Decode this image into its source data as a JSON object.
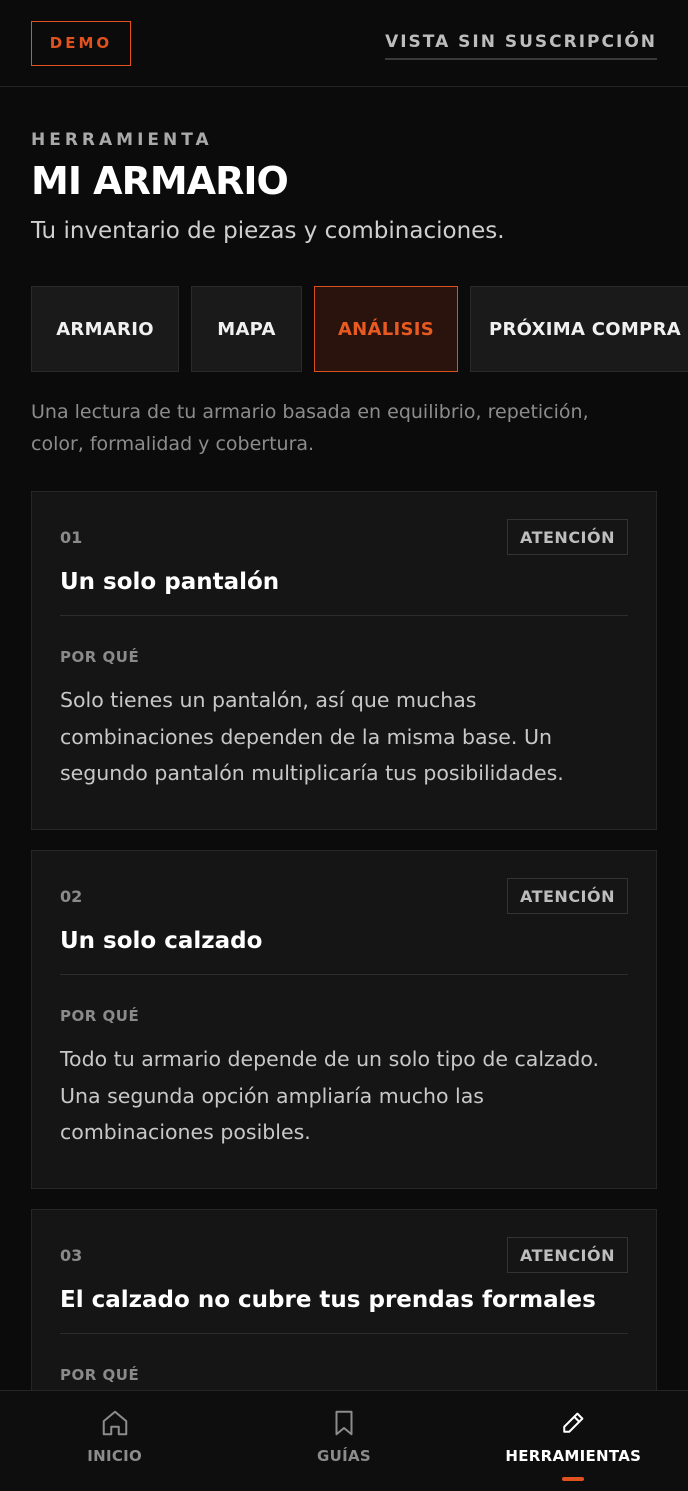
{
  "topbar": {
    "demo_label": "DEMO",
    "subscription_link": "VISTA SIN SUSCRIPCIÓN"
  },
  "header": {
    "kicker": "HERRAMIENTA",
    "title": "MI ARMARIO",
    "subtitle": "Tu inventario de piezas y combinaciones."
  },
  "tabs": [
    {
      "label": "ARMARIO",
      "active": false
    },
    {
      "label": "MAPA",
      "active": false
    },
    {
      "label": "ANÁLISIS",
      "active": true
    },
    {
      "label": "PRÓXIMA COMPRA",
      "active": false
    }
  ],
  "intro": "Una lectura de tu armario basada en equilibrio, repetición, color, formalidad y cobertura.",
  "cards": [
    {
      "number": "01",
      "badge": "ATENCIÓN",
      "title": "Un solo pantalón",
      "label": "POR QUÉ",
      "body": "Solo tienes un pantalón, así que muchas combinaciones dependen de la misma base. Un segundo pantalón multiplicaría tus posibilidades."
    },
    {
      "number": "02",
      "badge": "ATENCIÓN",
      "title": "Un solo calzado",
      "label": "POR QUÉ",
      "body": "Todo tu armario depende de un solo tipo de calzado. Una segunda opción ampliaría mucho las combinaciones posibles."
    },
    {
      "number": "03",
      "badge": "ATENCIÓN",
      "title": "El calzado no cubre tus prendas formales",
      "label": "POR QUÉ",
      "body": ""
    }
  ],
  "bottomnav": [
    {
      "label": "INICIO",
      "icon": "home-icon",
      "active": false
    },
    {
      "label": "GUÍAS",
      "icon": "bookmark-icon",
      "active": false
    },
    {
      "label": "HERRAMIENTAS",
      "icon": "pencil-icon",
      "active": true
    }
  ],
  "colors": {
    "accent": "#e0521f",
    "background": "#0b0b0b",
    "card": "#151515"
  }
}
